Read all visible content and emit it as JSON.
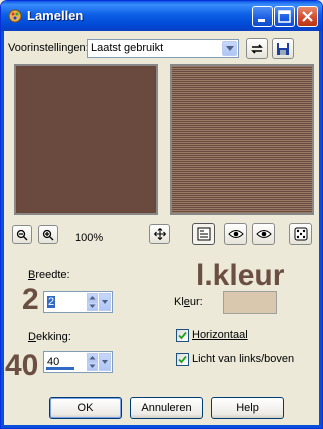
{
  "window": {
    "title": "Lamellen"
  },
  "presets": {
    "label": "Voorinstellingen:",
    "value": "Laatst gebruikt"
  },
  "zoom": {
    "level": "100%"
  },
  "overlay": {
    "width_number": "2",
    "opacity_number": "40",
    "color_heading": "l.kleur"
  },
  "width": {
    "label": "Breedte:",
    "value": "2"
  },
  "opacity": {
    "label": "Dekking:",
    "value": "40",
    "fill_fraction": 0.4
  },
  "color": {
    "label": "Kleur:",
    "swatch": "#d9c8ad"
  },
  "options": {
    "horizontal": {
      "label": "Horizontaal",
      "checked": true
    },
    "light": {
      "label": "Licht van links/boven",
      "checked": true
    }
  },
  "buttons": {
    "ok": "OK",
    "cancel": "Annuleren",
    "help": "Help"
  },
  "colors": {
    "preview_base": "#6a4a3e",
    "overlay_text": "#6b4f43",
    "titlebar": "#0a58e6"
  }
}
